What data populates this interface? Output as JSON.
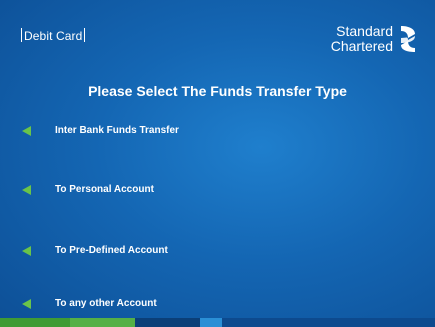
{
  "header": {
    "card_type": "Debit Card",
    "brand_line1": "Standard",
    "brand_line2": "Chartered",
    "brand_logo_icon": "standard-chartered-logo-icon"
  },
  "main": {
    "title": "Please Select The Funds Transfer Type",
    "options": [
      {
        "label": "Inter Bank Funds Transfer",
        "icon": "left-arrow-icon"
      },
      {
        "label": "To Personal Account",
        "icon": "left-arrow-icon"
      },
      {
        "label": "To Pre-Defined Account",
        "icon": "left-arrow-icon"
      },
      {
        "label": "To any other Account",
        "icon": "left-arrow-icon"
      }
    ]
  },
  "colors": {
    "background": "#1466b3",
    "arrow": "#69c44a",
    "strip_green": "#3f9b34",
    "strip_dark": "#0b3f78",
    "strip_light": "#2a8fd6"
  }
}
